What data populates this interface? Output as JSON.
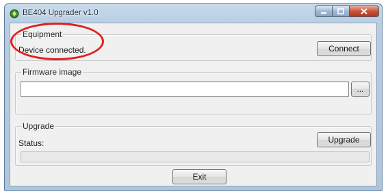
{
  "window": {
    "title": "BE404 Upgrader v1.0",
    "caption_buttons": {
      "minimize_icon": "minimize-icon",
      "maximize_icon": "maximize-icon",
      "close_icon": "close-icon"
    }
  },
  "equipment": {
    "group_label": "Equipment",
    "status_text": "Device connected.",
    "connect_label": "Connect"
  },
  "firmware": {
    "group_label": "Firmware image",
    "path_value": "",
    "browse_label": "..."
  },
  "upgrade": {
    "group_label": "Upgrade",
    "status_label": "Status:",
    "upgrade_label": "Upgrade",
    "progress": 0
  },
  "footer": {
    "exit_label": "Exit"
  },
  "annotation": {
    "highlight_color": "#e02020"
  }
}
